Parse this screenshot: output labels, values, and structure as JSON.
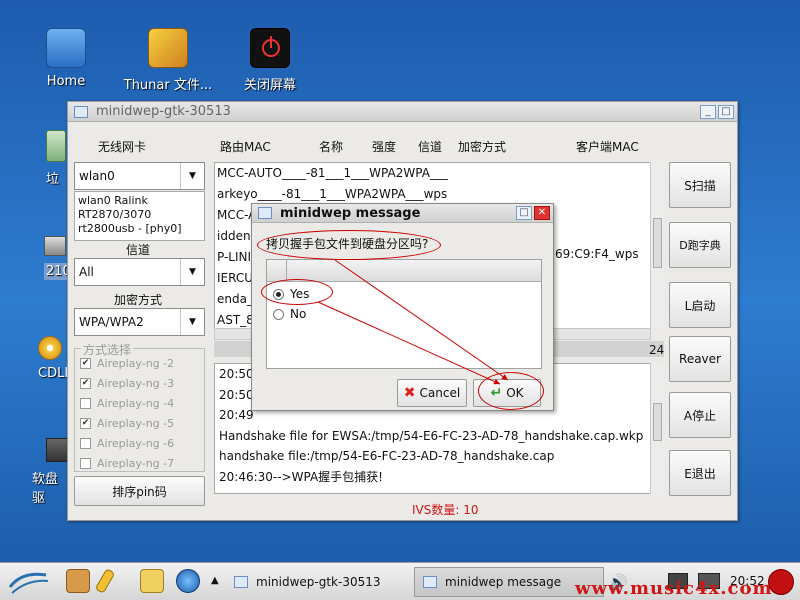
{
  "desktop": {
    "icons": [
      {
        "label": "Home"
      },
      {
        "label": "Thunar 文件..."
      },
      {
        "label": "关闭屏幕"
      }
    ],
    "partial_labels": [
      "垃",
      "210",
      "CDLI",
      "软盘驱"
    ]
  },
  "window": {
    "title": "minidwep-gtk-30513",
    "headers": {
      "wireless_card": "无线网卡",
      "router_mac": "路由MAC",
      "name": "名称",
      "strength": "强度",
      "channel": "信道",
      "encryption": "加密方式",
      "client_mac": "客户端MAC"
    },
    "nic_value": "wlan0",
    "nic_info": [
      "wlan0 Ralink",
      "RT2870/3070",
      "rt2800usb - [phy0]"
    ],
    "channel_label": "信道",
    "channel_value": "All",
    "encryption_label": "加密方式",
    "encryption_value": "WPA/WPA2",
    "mode_group_title": "方式选择",
    "modes": [
      {
        "label": "Aireplay-ng -2",
        "checked": true
      },
      {
        "label": "Aireplay-ng -3",
        "checked": true
      },
      {
        "label": "Aireplay-ng -4",
        "checked": false
      },
      {
        "label": "Aireplay-ng -5",
        "checked": true
      },
      {
        "label": "Aireplay-ng -6",
        "checked": false
      },
      {
        "label": "Aireplay-ng -7",
        "checked": false
      }
    ],
    "pin_sort_button": "排序pin码",
    "ap_rows": [
      "MCC-AUTO____-81___1___WPA2WPA___",
      "arkeyo____-81___1___WPA2WPA___wps",
      "MCC-A",
      "idden",
      "P-LINI",
      "IERCU",
      "enda_",
      "AST_8"
    ],
    "ap_extra": "69:C9:F4_wps",
    "count_label": "24",
    "log_rows": [
      "20:50",
      "20:50",
      "20:49",
      "Handshake file for EWSA:/tmp/54-E6-FC-23-AD-78_handshake.cap.wkp",
      "handshake file:/tmp/54-E6-FC-23-AD-78_handshake.cap",
      "20:46:30-->WPA握手包捕获!"
    ],
    "ivs_status": "IVS数量: 10",
    "buttons": {
      "scan": "S扫描",
      "dict": "D跑字典",
      "launch": "L启动",
      "reaver": "Reaver",
      "stop": "A停止",
      "exit": "E退出"
    }
  },
  "dialog": {
    "title": "minidwep message",
    "question": "拷贝握手包文件到硬盘分区吗?",
    "options": [
      {
        "label": "Yes",
        "selected": true
      },
      {
        "label": "No",
        "selected": false
      }
    ],
    "cancel": "Cancel",
    "ok": "OK"
  },
  "taskbar": {
    "tasks": [
      {
        "label": "minidwep-gtk-30513",
        "active": false
      },
      {
        "label": "minidwep message",
        "active": true
      }
    ],
    "clock": "20:52"
  },
  "watermark": "www.music4x.com",
  "colors": {
    "annotation_red": "#cc0000",
    "ivs_red": "#d01515",
    "desktop_blue": "#2e7ccf"
  }
}
